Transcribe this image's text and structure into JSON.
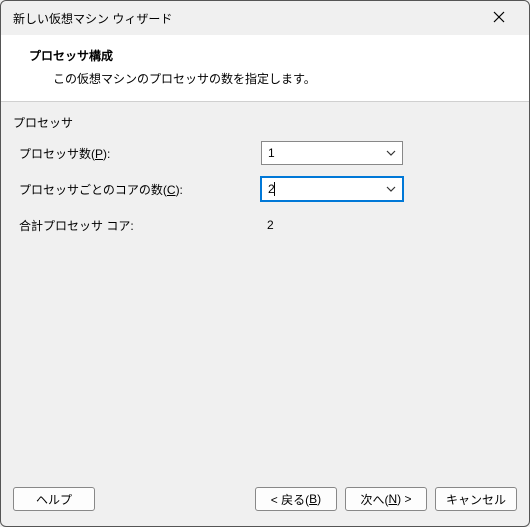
{
  "window": {
    "title": "新しい仮想マシン ウィザード"
  },
  "header": {
    "heading": "プロセッサ構成",
    "subheading": "この仮想マシンのプロセッサの数を指定します。"
  },
  "group": {
    "label": "プロセッサ"
  },
  "fields": {
    "processors": {
      "label_pre": "プロセッサ数(",
      "accel": "P",
      "label_post": "):",
      "value": "1"
    },
    "cores": {
      "label_pre": "プロセッサごとのコアの数(",
      "accel": "C",
      "label_post": "):",
      "value": "2"
    },
    "total": {
      "label": "合計プロセッサ コア:",
      "value": "2"
    }
  },
  "buttons": {
    "help": "ヘルプ",
    "back_pre": "< 戻る(",
    "back_accel": "B",
    "back_post": ")",
    "next_pre": "次へ(",
    "next_accel": "N",
    "next_post": ") >",
    "cancel": "キャンセル"
  }
}
